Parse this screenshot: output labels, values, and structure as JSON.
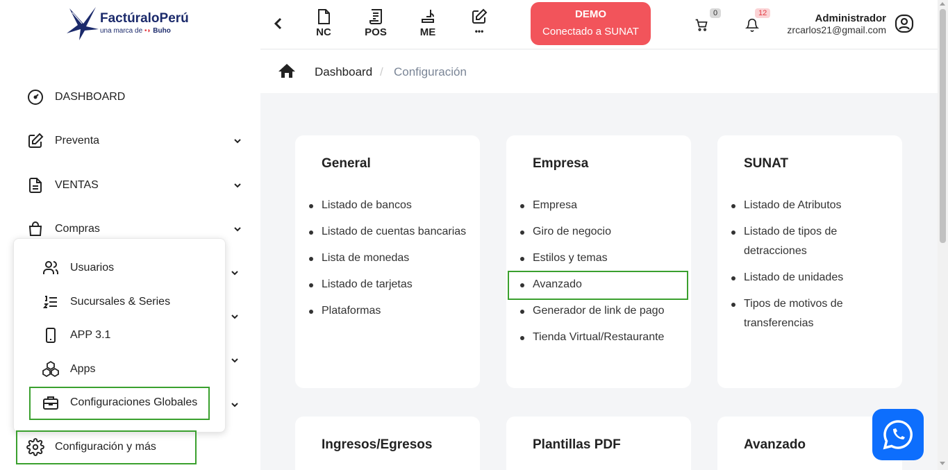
{
  "brand": {
    "name": "FactúraloPerú",
    "tagline_prefix": "una marca de",
    "tagline_brand": "Buho"
  },
  "sidebar": {
    "items": [
      {
        "label": "DASHBOARD",
        "icon": "speedometer-icon"
      },
      {
        "label": "Preventa",
        "icon": "pencil-square-icon"
      },
      {
        "label": "VENTAS",
        "icon": "document-icon"
      },
      {
        "label": "Compras",
        "icon": "shopping-bag-icon"
      }
    ],
    "popover": [
      {
        "label": "Usuarios",
        "icon": "users-icon"
      },
      {
        "label": "Sucursales & Series",
        "icon": "numbered-list-icon"
      },
      {
        "label": "APP 3.1",
        "icon": "mobile-phone-icon"
      },
      {
        "label": "Apps",
        "icon": "cubes-icon"
      },
      {
        "label": "Configuraciones Globales",
        "icon": "briefcase-icon"
      }
    ],
    "config": {
      "label": "Configuración y más",
      "icon": "gear-icon"
    }
  },
  "topbar": {
    "buttons": [
      {
        "label": "NC",
        "icon": "note-icon"
      },
      {
        "label": "POS",
        "icon": "receipt-icon"
      },
      {
        "label": "ME",
        "icon": "stamp-icon"
      },
      {
        "label": "•••",
        "icon": "edit-icon"
      }
    ],
    "demo": {
      "line1": "DEMO",
      "line2": "Conectado a SUNAT"
    },
    "cart_count": "0",
    "notif_count": "12",
    "user": {
      "name": "Administrador",
      "email": "zrcarlos21@gmail.com"
    }
  },
  "breadcrumb": {
    "home_icon": "home-icon",
    "level1": "Dashboard",
    "separator": "/",
    "level2": "Configuración"
  },
  "cards": [
    {
      "title": "General",
      "items": [
        "Listado de bancos",
        "Listado de cuentas bancarias",
        "Lista de monedas",
        "Listado de tarjetas",
        "Plataformas"
      ]
    },
    {
      "title": "Empresa",
      "items": [
        "Empresa",
        "Giro de negocio",
        "Estilos y temas",
        "Avanzado",
        "Generador de link de pago",
        "Tienda Virtual/Restaurante"
      ]
    },
    {
      "title": "SUNAT",
      "items": [
        "Listado de Atributos",
        "Listado de tipos de detracciones",
        "Listado de unidades",
        "Tipos de motivos de transferencias"
      ]
    },
    {
      "title": "Ingresos/Egresos",
      "items": []
    },
    {
      "title": "Plantillas PDF",
      "items": []
    },
    {
      "title": "Avanzado",
      "items": []
    }
  ],
  "colors": {
    "highlight": "#3aa02e",
    "demo": "#f2545b",
    "whatsapp": "#0d6efd",
    "brand": "#1b2a6b"
  }
}
